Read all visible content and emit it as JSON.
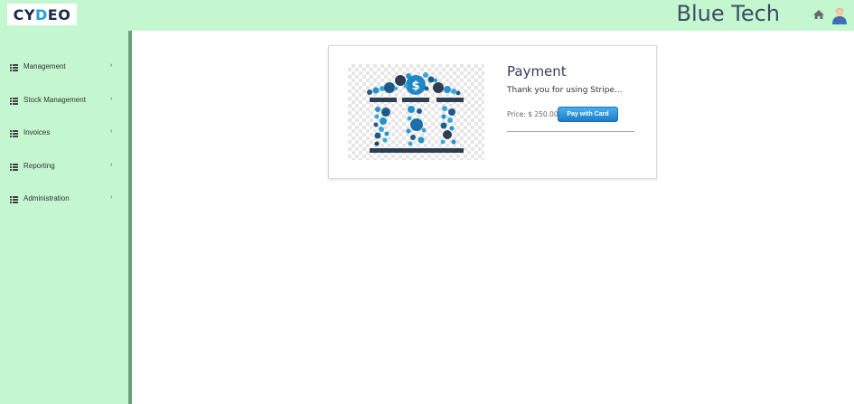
{
  "header": {
    "logo": {
      "part1": "CY",
      "part2": "DEO"
    },
    "company_name": "Blue Tech",
    "icons": [
      "home-icon",
      "user-avatar-icon"
    ]
  },
  "sidebar": {
    "items": [
      {
        "label": "Management",
        "icon": "list-icon",
        "chevron": "›"
      },
      {
        "label": "Stock Management",
        "icon": "list-icon",
        "chevron": "›"
      },
      {
        "label": "Invoices",
        "icon": "list-icon",
        "chevron": "›"
      },
      {
        "label": "Reporting",
        "icon": "list-icon",
        "chevron": "›"
      },
      {
        "label": "Administration",
        "icon": "list-icon",
        "chevron": "›"
      }
    ]
  },
  "payment_card": {
    "image": "bank-icon",
    "title": "Payment",
    "text": "Thank you for using Stripe...",
    "price": "Price: $ 250.00",
    "button_label": "Pay with Card"
  },
  "colors": {
    "header_bg": "#c4f6cf",
    "sidebar_bg": "#c4f6cf",
    "sidebar_border": "#68a07b",
    "button": "#2b8fdc",
    "title": "#2f3f5c"
  }
}
